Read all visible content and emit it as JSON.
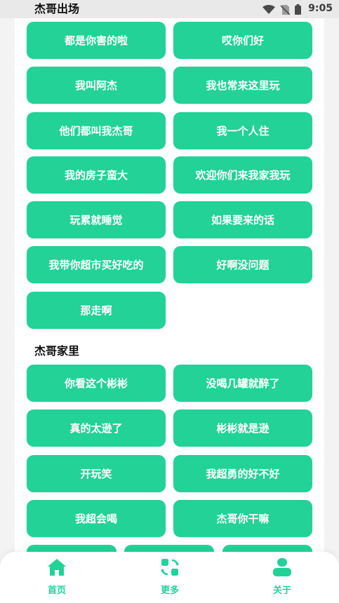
{
  "status_bar": {
    "time": "9:05"
  },
  "sections": {
    "s1": {
      "title": "杰哥出场",
      "buttons": [
        "都是你害的啦",
        "哎你们好",
        "我叫阿杰",
        "我也常来这里玩",
        "他们都叫我杰哥",
        "我一个人住",
        "我的房子蛮大",
        "欢迎你们来我家我玩",
        "玩累就睡觉",
        "如果要来的话",
        "我带你超市买好吃的",
        "好啊没问题",
        "那走啊"
      ]
    },
    "s2": {
      "title": "杰哥家里",
      "buttons": [
        "你看这个彬彬",
        "没喝几罐就醉了",
        "真的太逊了",
        "彬彬就是逊",
        "开玩笑",
        "我超勇的好不好",
        "我超会喝",
        "杰哥你干嘛"
      ]
    }
  },
  "tabbar": {
    "home": "首页",
    "more": "更多",
    "about": "关于"
  },
  "colors": {
    "accent": "#22d297",
    "background": "#f2f3f2"
  }
}
